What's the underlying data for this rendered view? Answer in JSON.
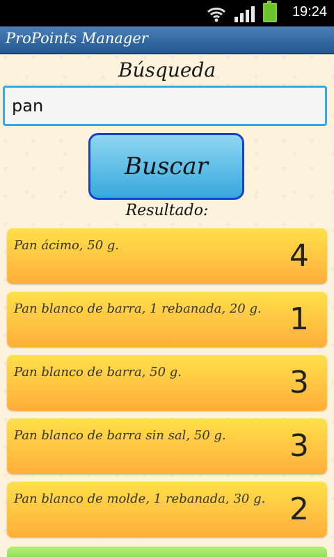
{
  "status_bar": {
    "time": "19:24"
  },
  "app": {
    "title": "ProPoints Manager"
  },
  "search": {
    "heading": "Búsqueda",
    "value": "pan",
    "button_label": "Buscar"
  },
  "results": {
    "label": "Resultado:",
    "items": [
      {
        "name": "Pan ácimo, 50 g.",
        "points": "4"
      },
      {
        "name": "Pan blanco de barra, 1 rebanada, 20 g.",
        "points": "1"
      },
      {
        "name": "Pan blanco de barra, 50 g.",
        "points": "3"
      },
      {
        "name": "Pan blanco de barra sin sal, 50 g.",
        "points": "3"
      },
      {
        "name": "Pan blanco de molde, 1 rebanada, 30 g.",
        "points": "2"
      }
    ]
  }
}
